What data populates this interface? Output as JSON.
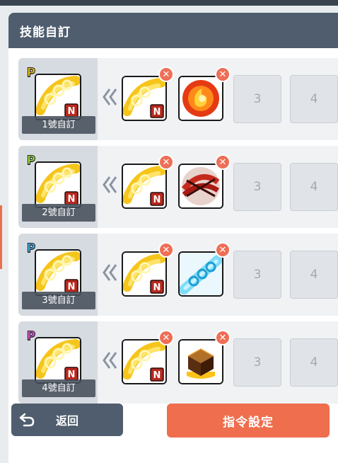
{
  "panel": {
    "title": "技能自訂"
  },
  "rows": [
    {
      "label": "1號自訂",
      "p_badge": "P",
      "p_color": "#f2c40f",
      "second_skill_icon": "fire-orb-icon",
      "empty_slots": [
        "3",
        "4"
      ]
    },
    {
      "label": "2號自訂",
      "p_badge": "P",
      "p_color": "#9be23a",
      "second_skill_icon": "crimson-slash-icon",
      "empty_slots": [
        "3",
        "4"
      ]
    },
    {
      "label": "3號自訂",
      "p_badge": "P",
      "p_color": "#3fb4ef",
      "second_skill_icon": "ice-chain-icon",
      "empty_slots": [
        "3",
        "4"
      ]
    },
    {
      "label": "4號自訂",
      "p_badge": "P",
      "p_color": "#e04fd4",
      "second_skill_icon": "lava-cube-icon",
      "empty_slots": [
        "3",
        "4"
      ]
    }
  ],
  "buttons": {
    "back": "返回",
    "command": "指令設定"
  },
  "colors": {
    "header": "#4f5d6e",
    "accent": "#ee6e4e",
    "remove": "#ee6e56"
  }
}
